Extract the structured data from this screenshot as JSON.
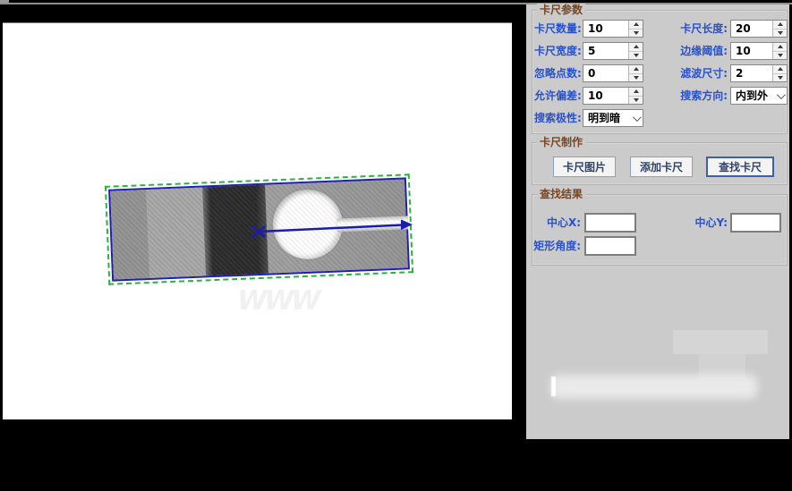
{
  "panel": {
    "caliper_params": {
      "title": "卡尺参数",
      "fields": [
        {
          "label": "卡尺数量:",
          "value": "10"
        },
        {
          "label": "卡尺长度:",
          "value": "20"
        },
        {
          "label": "卡尺宽度:",
          "value": "5"
        },
        {
          "label": "边缘阈值:",
          "value": "10"
        },
        {
          "label": "忽略点数:",
          "value": "0"
        },
        {
          "label": "滤波尺寸:",
          "value": "2"
        },
        {
          "label": "允许偏差:",
          "value": "10"
        },
        {
          "label": "搜索方向:",
          "value": "内到外"
        },
        {
          "label": "搜索极性:",
          "value": "明到暗"
        }
      ]
    },
    "caliper_make": {
      "title": "卡尺制作",
      "buttons": [
        {
          "label": "卡尺图片"
        },
        {
          "label": "添加卡尺"
        },
        {
          "label": "查找卡尺"
        }
      ]
    },
    "find_result": {
      "title": "查找结果",
      "fields": [
        {
          "label": "中心X:",
          "value": ""
        },
        {
          "label": "中心Y:",
          "value": ""
        },
        {
          "label": "矩形角度:",
          "value": ""
        }
      ]
    }
  },
  "canvas": {
    "faint_mark": "WWW"
  },
  "icons": {
    "spinner_up": "triangle-up",
    "spinner_down": "triangle-down",
    "combo_chevron": "chevron-down",
    "roi_arrow": "measure-direction-arrow"
  },
  "colors": {
    "panel_bg": "#cbcbcb",
    "label_blue": "#2a52c8",
    "group_title_maroon": "#7a4522",
    "roi_blue": "#1e1eb2",
    "caliper_green": "#28b43c",
    "button_border": "#8ba0c6",
    "button_focus_border": "#3c5fae"
  }
}
